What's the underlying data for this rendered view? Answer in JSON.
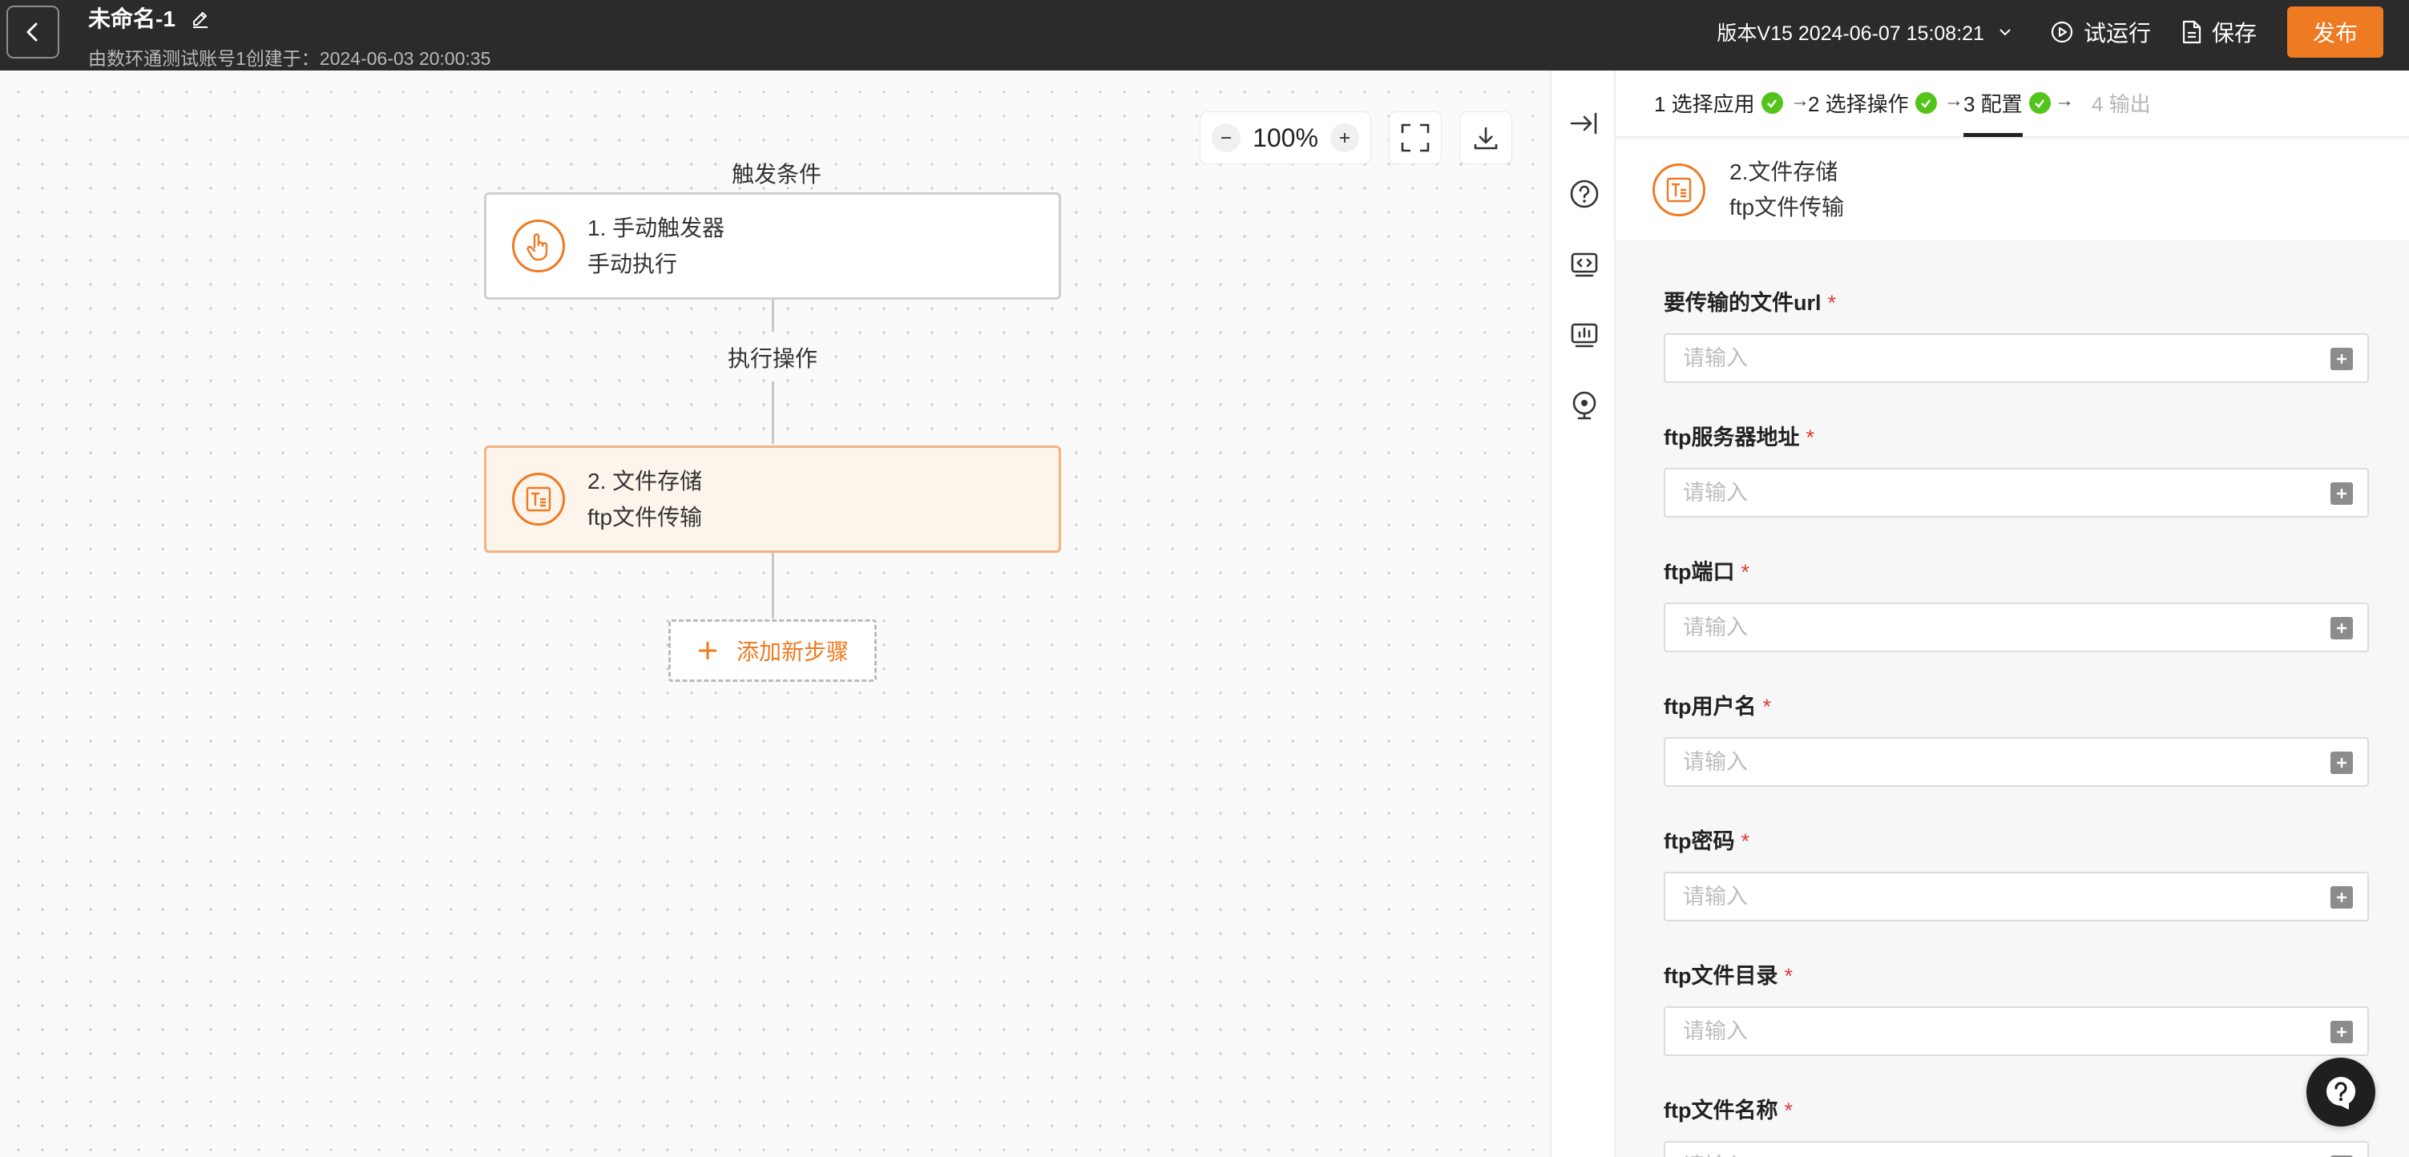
{
  "topbar": {
    "title": "未命名-1",
    "subtitle": "由数环通测试账号1创建于：2024-06-03 20:00:35",
    "version": "版本V15 2024-06-07 15:08:21",
    "trial_run": "试运行",
    "save": "保存",
    "publish": "发布",
    "accent": "#ee7a22"
  },
  "canvas": {
    "zoom": "100%",
    "trigger_label": "触发条件",
    "action_label": "执行操作",
    "nodes": [
      {
        "title": "1. 手动触发器",
        "subtitle": "手动执行",
        "icon": "hand-pointer-icon"
      },
      {
        "title": "2. 文件存储",
        "subtitle": "ftp文件传输",
        "icon": "file-storage-icon"
      }
    ],
    "add_step": "添加新步骤"
  },
  "panel": {
    "steps": [
      {
        "label": "1 选择应用",
        "done": true
      },
      {
        "label": "2 选择操作",
        "done": true
      },
      {
        "label": "3 配置",
        "done": true
      },
      {
        "label": "4 输出",
        "done": false
      }
    ],
    "app_title": "2.文件存储",
    "app_subtitle": "ftp文件传输",
    "placeholder": "请输入",
    "fields": [
      {
        "label": "要传输的文件url",
        "required": true
      },
      {
        "label": "ftp服务器地址",
        "required": true
      },
      {
        "label": "ftp端口",
        "required": true
      },
      {
        "label": "ftp用户名",
        "required": true
      },
      {
        "label": "ftp密码",
        "required": true
      },
      {
        "label": "ftp文件目录",
        "required": true
      },
      {
        "label": "ftp文件名称",
        "required": true
      }
    ],
    "required_mark": "*"
  }
}
